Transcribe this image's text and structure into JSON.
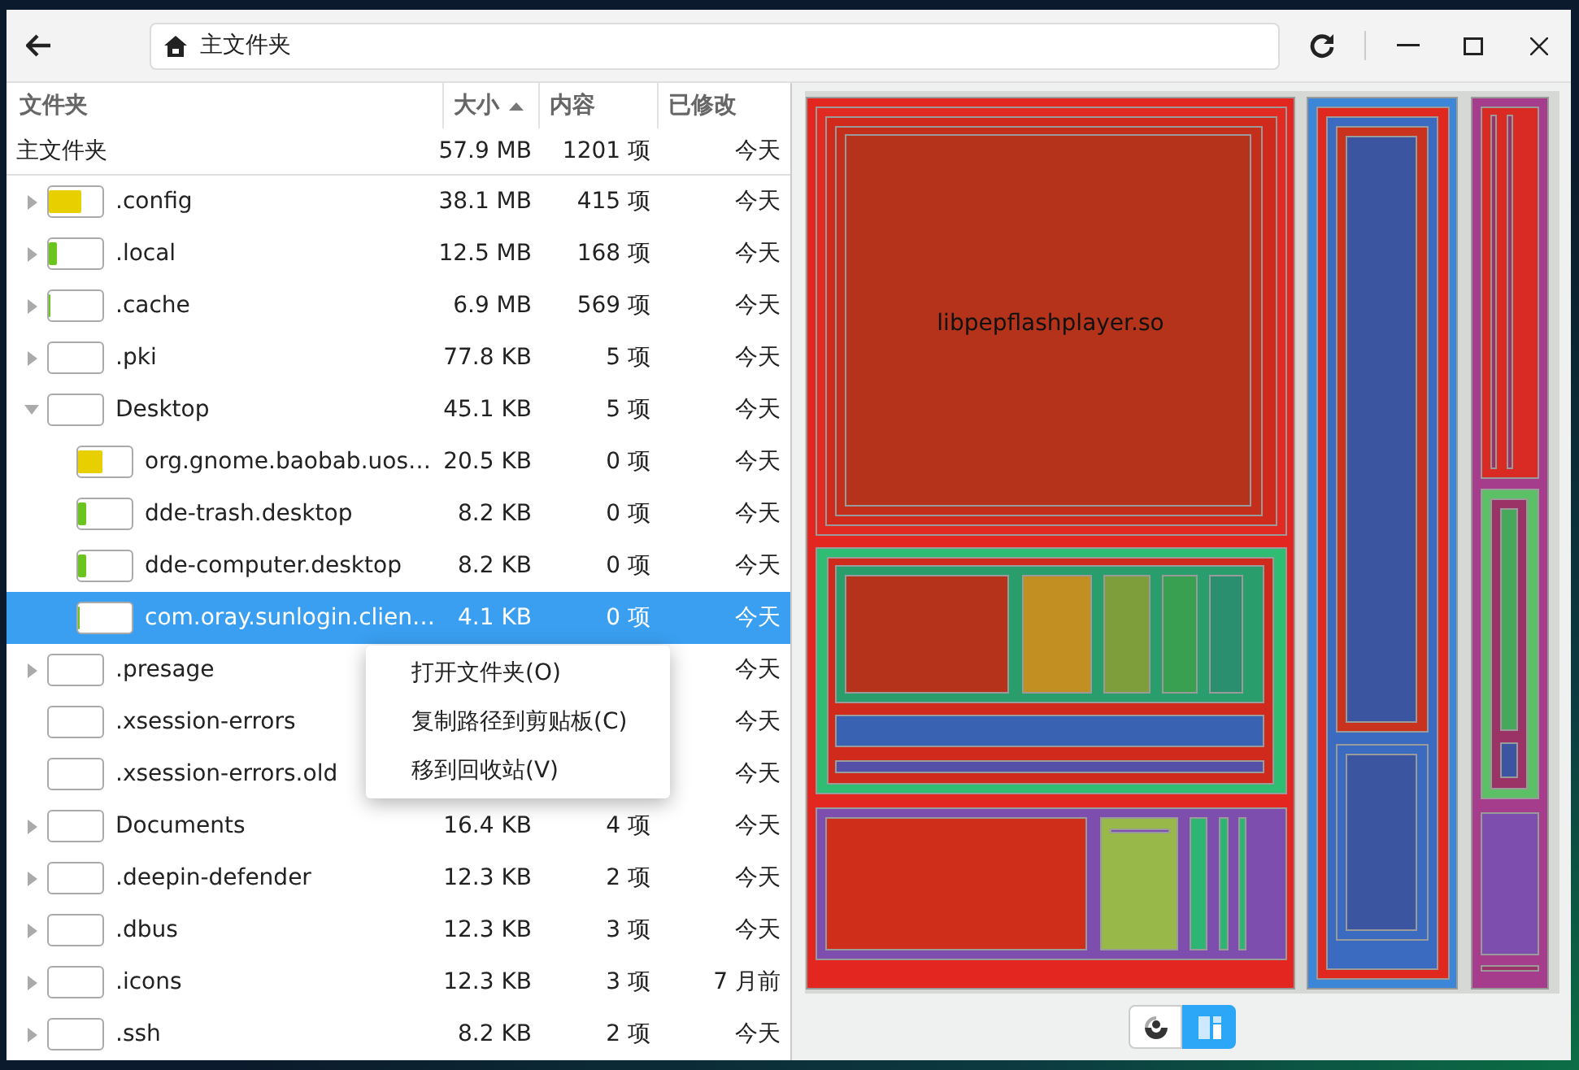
{
  "location": "主文件夹",
  "columns": [
    {
      "label": "文件夹",
      "sorted": false
    },
    {
      "label": "大小",
      "sorted": true
    },
    {
      "label": "内容",
      "sorted": false
    },
    {
      "label": "已修改",
      "sorted": false
    }
  ],
  "root": {
    "name": "主文件夹",
    "size": "57.9 MB",
    "contents": "1201 项",
    "modified": "今天"
  },
  "rows": [
    {
      "name": ".config",
      "size": "38.1 MB",
      "contents": "415 项",
      "modified": "今天",
      "expanded": false,
      "selected": false,
      "level": 0.6,
      "color": "#e8cf00"
    },
    {
      "name": ".local",
      "size": "12.5 MB",
      "contents": "168 项",
      "modified": "今天",
      "expanded": false,
      "selected": false,
      "level": 0.15,
      "color": "#6cc51e"
    },
    {
      "name": ".cache",
      "size": "6.9 MB",
      "contents": "569 项",
      "modified": "今天",
      "expanded": false,
      "selected": false,
      "level": 0.04,
      "color": "#6cc51e"
    },
    {
      "name": ".pki",
      "size": "77.8 KB",
      "contents": "5 项",
      "modified": "今天",
      "expanded": false,
      "selected": false
    },
    {
      "name": "Desktop",
      "size": "45.1 KB",
      "contents": "5 项",
      "modified": "今天",
      "expanded": true,
      "selected": false,
      "children": [
        {
          "name": "org.gnome.baobab.uos…",
          "size": "20.5 KB",
          "contents": "0 项",
          "modified": "今天",
          "selected": false,
          "level": 0.45,
          "color": "#e8cf00"
        },
        {
          "name": "dde-trash.desktop",
          "size": "8.2 KB",
          "contents": "0 项",
          "modified": "今天",
          "selected": false,
          "level": 0.15,
          "color": "#6cc51e"
        },
        {
          "name": "dde-computer.desktop",
          "size": "8.2 KB",
          "contents": "0 项",
          "modified": "今天",
          "selected": false,
          "level": 0.15,
          "color": "#6cc51e"
        },
        {
          "name": "com.oray.sunlogin.clien…",
          "size": "4.1 KB",
          "contents": "0 项",
          "modified": "今天",
          "selected": true,
          "level": 0.04,
          "color": "#6cc51e"
        }
      ]
    },
    {
      "name": ".presage",
      "modified": "今天",
      "expanded": false,
      "selected": false
    },
    {
      "name": ".xsession-errors",
      "modified": "今天",
      "selected": false
    },
    {
      "name": ".xsession-errors.old",
      "modified": "今天",
      "selected": false
    },
    {
      "name": "Documents",
      "size": "16.4 KB",
      "contents": "4 项",
      "modified": "今天",
      "expanded": false,
      "selected": false
    },
    {
      "name": ".deepin-defender",
      "size": "12.3 KB",
      "contents": "2 项",
      "modified": "今天",
      "expanded": false,
      "selected": false
    },
    {
      "name": ".dbus",
      "size": "12.3 KB",
      "contents": "3 项",
      "modified": "今天",
      "expanded": false,
      "selected": false
    },
    {
      "name": ".icons",
      "size": "12.3 KB",
      "contents": "3 项",
      "modified": "7 月前",
      "expanded": false,
      "selected": false
    },
    {
      "name": ".ssh",
      "size": "8.2 KB",
      "contents": "2 项",
      "modified": "今天",
      "expanded": false,
      "selected": false
    }
  ],
  "context_menu": [
    "打开文件夹(O)",
    "复制路径到剪贴板(C)",
    "移到回收站(V)"
  ],
  "treemap": {
    "label": "libpepflashplayer.so"
  },
  "view_toggle": [
    {
      "kind": "rings",
      "selected": false
    },
    {
      "kind": "treemap",
      "selected": true
    }
  ]
}
